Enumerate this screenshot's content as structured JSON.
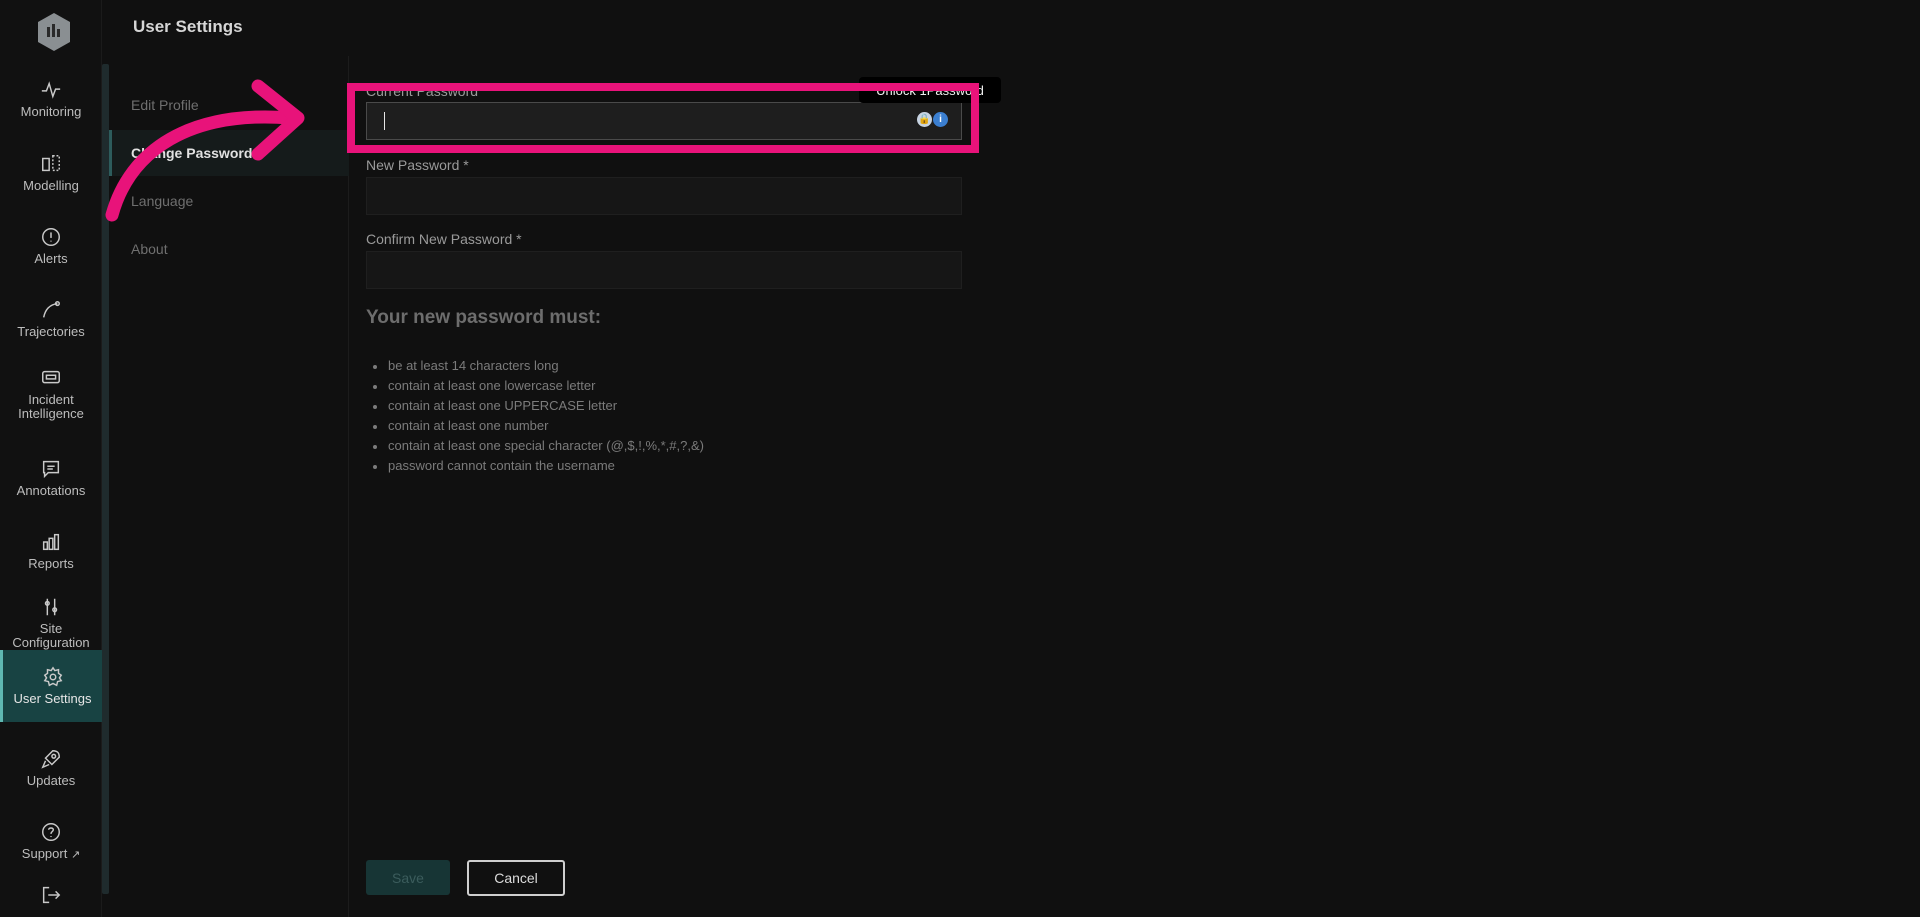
{
  "header": {
    "title": "User Settings"
  },
  "sidebar": {
    "items": [
      {
        "label": "Monitoring",
        "icon": "monitoring-icon"
      },
      {
        "label": "Modelling",
        "icon": "modelling-icon"
      },
      {
        "label": "Alerts",
        "icon": "alert-icon"
      },
      {
        "label": "Trajectories",
        "icon": "trajectory-icon"
      },
      {
        "label": "Incident Intelligence",
        "icon": "incident-icon"
      },
      {
        "label": "Annotations",
        "icon": "annotation-icon"
      },
      {
        "label": "Reports",
        "icon": "reports-icon"
      },
      {
        "label": "Site Configuration",
        "icon": "sliders-icon"
      },
      {
        "label": "User Settings",
        "icon": "gear-icon"
      },
      {
        "label": "Updates",
        "icon": "rocket-icon"
      },
      {
        "label": "Support",
        "icon": "help-icon"
      }
    ],
    "active": "User Settings"
  },
  "subnav": {
    "items": [
      "Edit Profile",
      "Change Password",
      "Language",
      "About"
    ],
    "active": "Change Password"
  },
  "form": {
    "current_password_label": "Current Password",
    "new_password_label": "New Password *",
    "confirm_password_label": "Confirm New Password *",
    "current_password_value": "",
    "new_password_value": "",
    "confirm_password_value": ""
  },
  "tooltip": {
    "text": "Unlock 1Password"
  },
  "rules": {
    "title": "Your new password must:",
    "items": [
      "be at least 14 characters long",
      "contain at least one lowercase letter",
      "contain at least one UPPERCASE letter",
      "contain at least one number",
      "contain at least one special character (@,$,!,%,*,#,?,&)",
      "password cannot contain the username"
    ]
  },
  "buttons": {
    "save": "Save",
    "cancel": "Cancel"
  },
  "colors": {
    "accent": "#5fb8b2",
    "active_bg": "#184343",
    "annotation": "#e8137a"
  }
}
